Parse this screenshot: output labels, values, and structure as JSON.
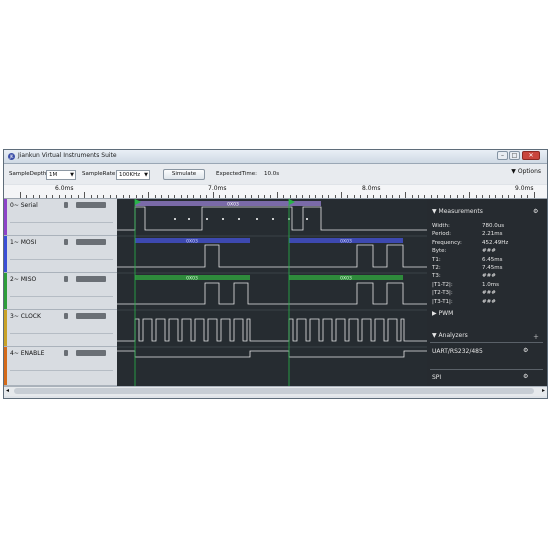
{
  "window": {
    "title": "Jiankun Virtual Instruments Suite",
    "icon": "app-logo-icon",
    "controls": [
      "minimize",
      "maximize",
      "close"
    ]
  },
  "toolbar": {
    "sample_depth_label": "SampleDepth",
    "sample_depth_value": "1M",
    "sample_rate_label": "SampleRate",
    "sample_rate_value": "100KHz",
    "simulate_label": "Simulate",
    "expected_time_label": "ExpectedTime:",
    "expected_time_value": "10.0s",
    "options_label": "Options"
  },
  "ruler": {
    "labels": [
      "6.0ms",
      "7.0ms",
      "8.0ms",
      "9.0ms"
    ]
  },
  "channels": [
    {
      "label": "0~ Serial",
      "color": "#8e44c8"
    },
    {
      "label": "1~ MOSI",
      "color": "#3b4fd6"
    },
    {
      "label": "2~ MISO",
      "color": "#2e9e3b"
    },
    {
      "label": "3~ CLOCK",
      "color": "#c9a227"
    },
    {
      "label": "4~ ENABLE",
      "color": "#d46a1a"
    }
  ],
  "waveforms": {
    "bus_label": "0X03",
    "bus_color_serial": "#7a6aa8",
    "bus_color_mosi": "#3d49b0",
    "bus_color_miso": "#2e8a3b",
    "marker_color": "#29b34a"
  },
  "measurements": {
    "title": "Measurements",
    "rows": [
      {
        "label": "Width:",
        "value": "780.0us"
      },
      {
        "label": "Period:",
        "value": "2.21ms"
      },
      {
        "label": "Frequency:",
        "value": "452.49Hz"
      },
      {
        "label": "Byte:",
        "value": "###"
      },
      {
        "label": "T1:",
        "value": "6.45ms"
      },
      {
        "label": "T2:",
        "value": "7.45ms"
      },
      {
        "label": "T3:",
        "value": "###"
      },
      {
        "label": "|T1-T2|:",
        "value": "1.0ms"
      },
      {
        "label": "|T2-T3|:",
        "value": "###"
      },
      {
        "label": "|T3-T1|:",
        "value": "###"
      }
    ]
  },
  "pwm": {
    "title": "PWM"
  },
  "analyzers": {
    "title": "Analyzers",
    "items": [
      "UART/RS232/485",
      "SPI"
    ]
  }
}
